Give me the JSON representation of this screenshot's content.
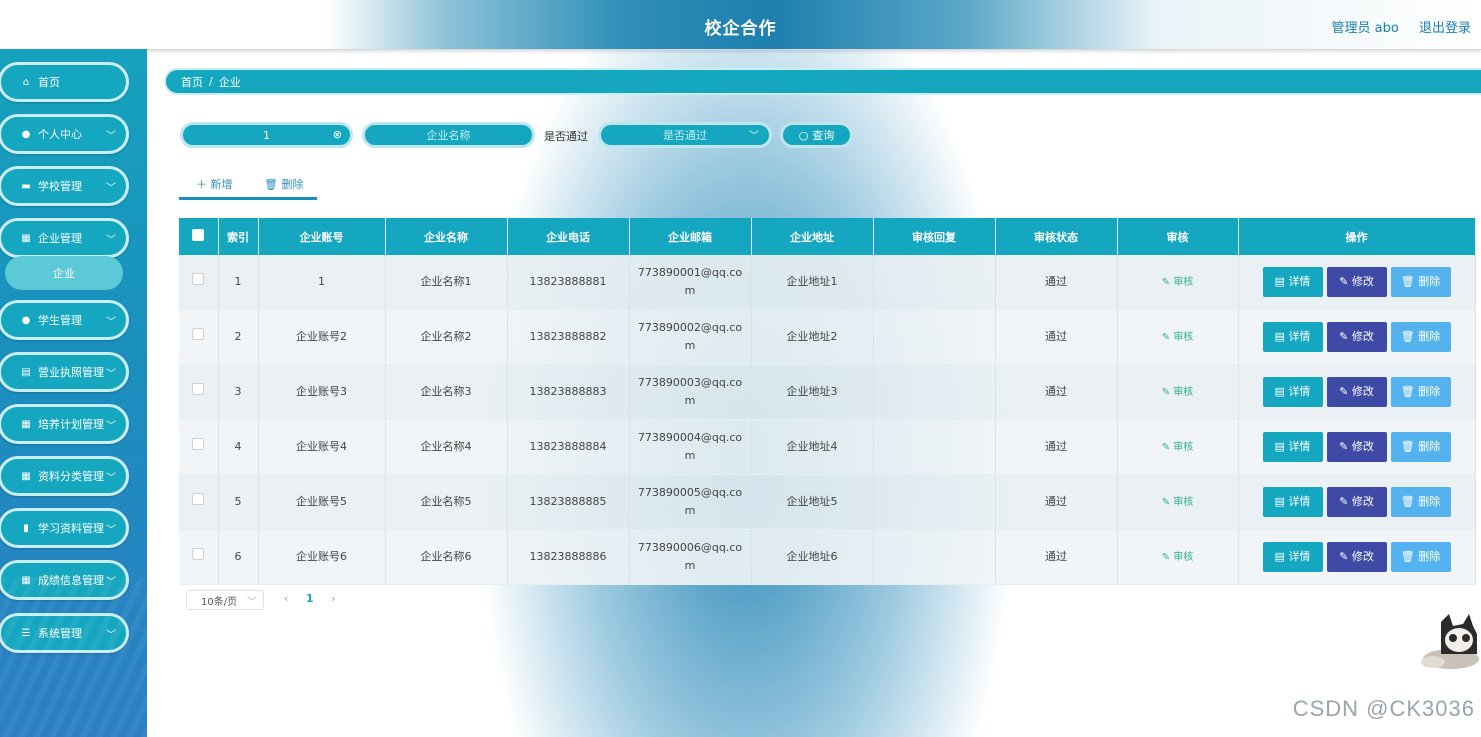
{
  "app": {
    "title": "校企合作"
  },
  "user": {
    "name": "管理员 abo",
    "logout": "退出登录"
  },
  "sidebar": {
    "items": [
      {
        "label": "首页",
        "icon": "home-icon"
      },
      {
        "label": "个人中心",
        "icon": "user-icon"
      },
      {
        "label": "学校管理",
        "icon": "bank-icon"
      },
      {
        "label": "企业管理",
        "icon": "grid-icon"
      },
      {
        "label": "学生管理",
        "icon": "user-icon"
      },
      {
        "label": "营业执照管理",
        "icon": "doc-icon"
      },
      {
        "label": "培养计划管理",
        "icon": "grid-icon"
      },
      {
        "label": "资料分类管理",
        "icon": "grid-icon"
      },
      {
        "label": "学习资料管理",
        "icon": "chart-icon"
      },
      {
        "label": "成绩信息管理",
        "icon": "grid-icon"
      },
      {
        "label": "系统管理",
        "icon": "sliders-icon"
      }
    ],
    "submenu": {
      "label": "企业"
    }
  },
  "breadcrumb": {
    "home": "首页",
    "sep": "/",
    "current": "企业"
  },
  "search": {
    "account_value": "1",
    "name_placeholder": "企业名称",
    "pass_label": "是否通过",
    "pass_placeholder": "是否通过",
    "query_label": "查询"
  },
  "actions": {
    "add_label": "新增",
    "delete_label": "删除"
  },
  "table": {
    "headers": [
      "索引",
      "企业账号",
      "企业名称",
      "企业电话",
      "企业邮箱",
      "企业地址",
      "审核回复",
      "审核状态",
      "审核",
      "操作"
    ],
    "audit_label": "审核",
    "detail_label": "详情",
    "edit_label": "修改",
    "delete_label": "删除",
    "rows": [
      {
        "index": "1",
        "account": "1",
        "name": "企业名称1",
        "phone": "13823888881",
        "email": "773890001@qq.com",
        "address": "企业地址1",
        "reply": "",
        "status": "通过"
      },
      {
        "index": "2",
        "account": "企业账号2",
        "name": "企业名称2",
        "phone": "13823888882",
        "email": "773890002@qq.com",
        "address": "企业地址2",
        "reply": "",
        "status": "通过"
      },
      {
        "index": "3",
        "account": "企业账号3",
        "name": "企业名称3",
        "phone": "13823888883",
        "email": "773890003@qq.com",
        "address": "企业地址3",
        "reply": "",
        "status": "通过"
      },
      {
        "index": "4",
        "account": "企业账号4",
        "name": "企业名称4",
        "phone": "13823888884",
        "email": "773890004@qq.com",
        "address": "企业地址4",
        "reply": "",
        "status": "通过"
      },
      {
        "index": "5",
        "account": "企业账号5",
        "name": "企业名称5",
        "phone": "13823888885",
        "email": "773890005@qq.com",
        "address": "企业地址5",
        "reply": "",
        "status": "通过"
      },
      {
        "index": "6",
        "account": "企业账号6",
        "name": "企业名称6",
        "phone": "13823888886",
        "email": "773890006@qq.com",
        "address": "企业地址6",
        "reply": "",
        "status": "通过"
      }
    ]
  },
  "pagination": {
    "page_size": "10条/页",
    "current_page": "1"
  },
  "watermark": "CSDN @CK3036",
  "colors": {
    "primary": "#16a7c0",
    "edit": "#3e4aa6",
    "delete": "#54b3ee",
    "audit": "#2fb38a"
  }
}
